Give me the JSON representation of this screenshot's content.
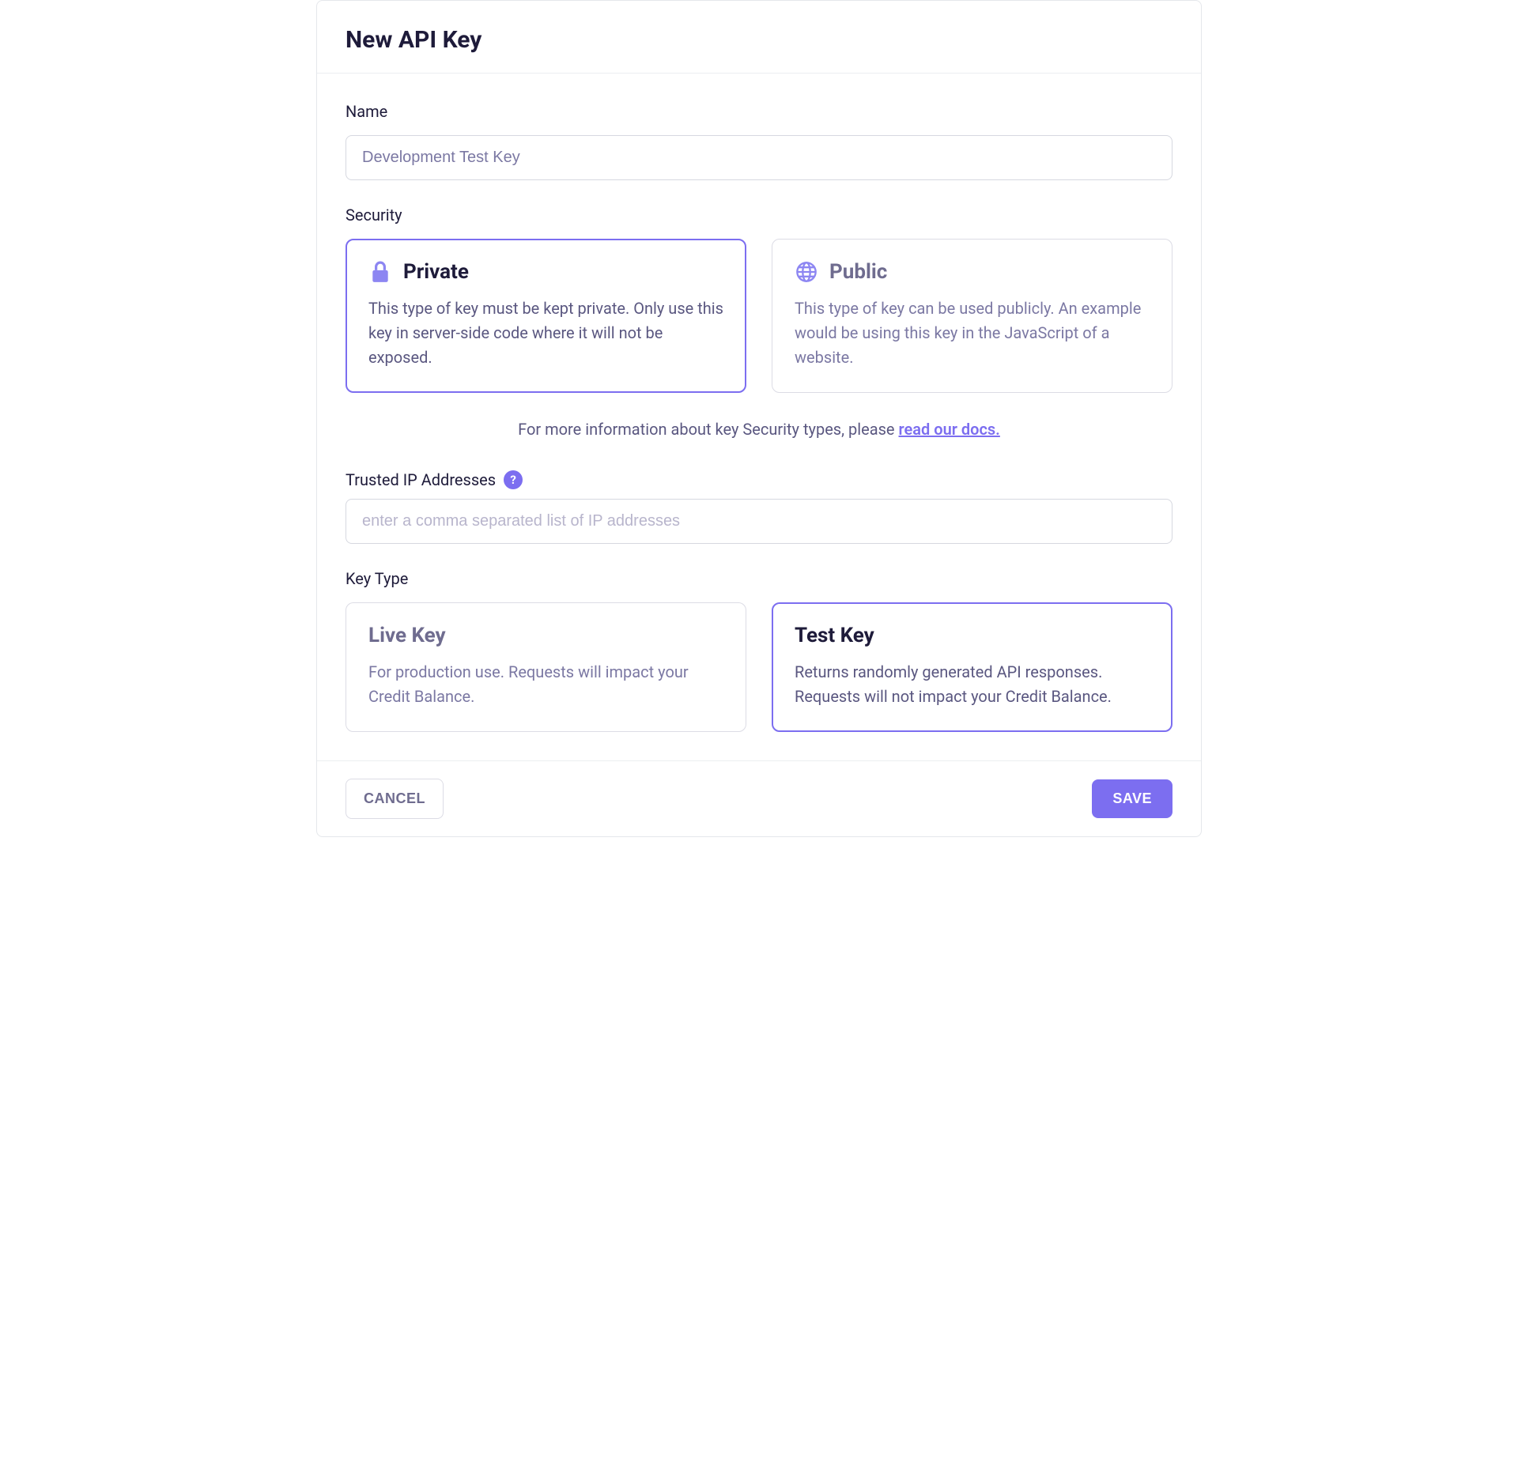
{
  "header": {
    "title": "New API Key"
  },
  "name": {
    "label": "Name",
    "value": "Development Test Key"
  },
  "security": {
    "label": "Security",
    "options": [
      {
        "title": "Private",
        "description": "This type of key must be kept private. Only use this key in server-side code where it will not be exposed.",
        "selected": true,
        "icon": "lock-icon"
      },
      {
        "title": "Public",
        "description": "This type of key can be used publicly. An example would be using this key in the JavaScript of a website.",
        "selected": false,
        "icon": "globe-icon"
      }
    ],
    "help_prefix": "For more information about key Security types, please ",
    "help_link_text": "read our docs."
  },
  "trustedIps": {
    "label": "Trusted IP Addresses",
    "placeholder": "enter a comma separated list of IP addresses",
    "tooltip": "?"
  },
  "keyType": {
    "label": "Key Type",
    "options": [
      {
        "title": "Live Key",
        "description": "For production use. Requests will impact your Credit Balance.",
        "selected": false
      },
      {
        "title": "Test Key",
        "description": "Returns randomly generated API responses. Requests will not impact your Credit Balance.",
        "selected": true
      }
    ]
  },
  "footer": {
    "cancel_label": "CANCEL",
    "save_label": "SAVE"
  },
  "colors": {
    "accent": "#7c6ef0",
    "text_primary": "#1e1b3a",
    "text_muted": "#7b78a3",
    "border": "#dcdce5"
  }
}
